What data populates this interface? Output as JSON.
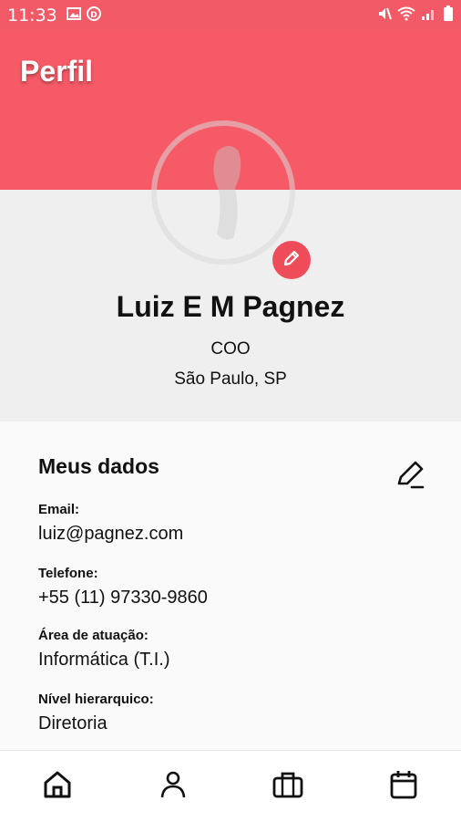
{
  "status_bar": {
    "time": "11:33",
    "icons": [
      "image-icon",
      "d-app-icon",
      "mute-icon",
      "wifi-icon",
      "signal-icon",
      "battery-icon"
    ]
  },
  "header": {
    "title": "Perfil",
    "color": "#f55a66"
  },
  "profile": {
    "name": "Luiz E M Pagnez",
    "role": "COO",
    "location": "São Paulo, SP",
    "edit_icon": "pencil-icon",
    "edit_color": "#ef4c5a"
  },
  "my_data": {
    "title": "Meus dados",
    "edit_icon": "edit-icon",
    "fields": [
      {
        "label": "Email:",
        "value": "luiz@pagnez.com"
      },
      {
        "label": "Telefone:",
        "value": "+55 (11) 97330-9860"
      },
      {
        "label": "Área de atuação:",
        "value": "Informática (T.I.)"
      },
      {
        "label": "Nível hierarquico:",
        "value": "Diretoria"
      }
    ]
  },
  "bottom_nav": {
    "items": [
      "home-icon",
      "person-icon",
      "briefcase-icon",
      "calendar-icon"
    ]
  }
}
